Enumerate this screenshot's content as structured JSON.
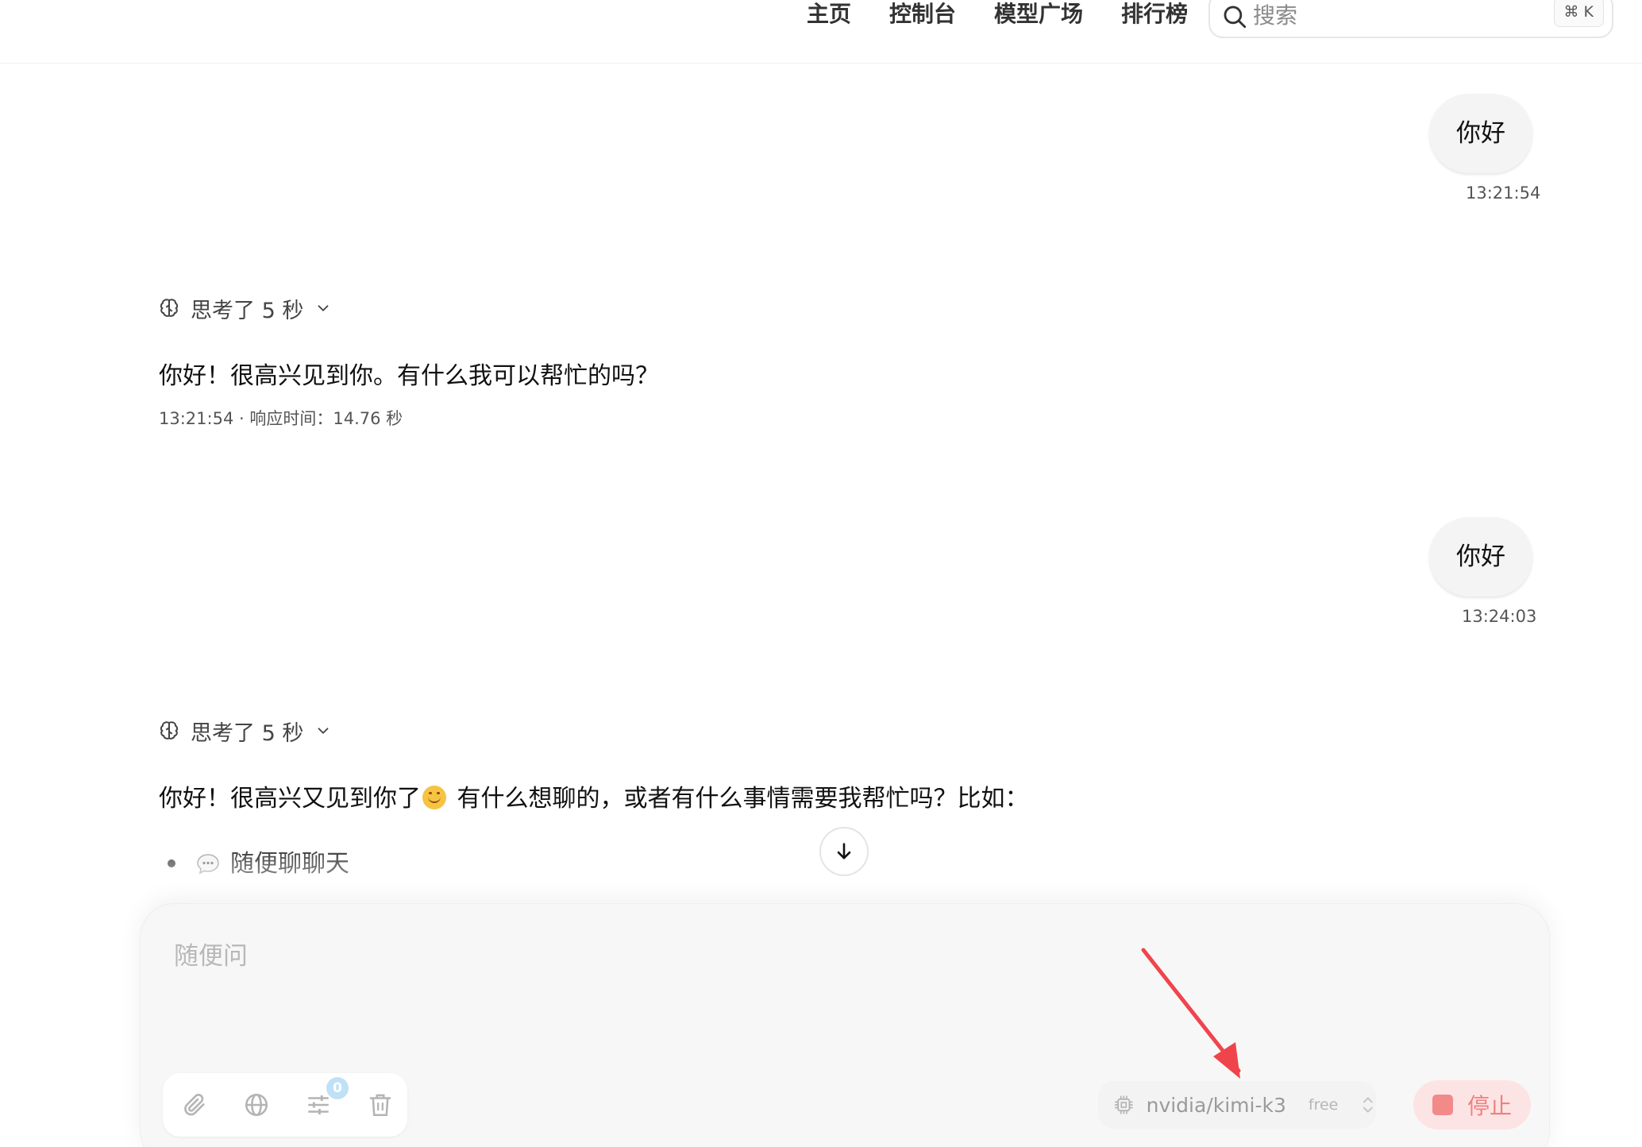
{
  "nav": {
    "links": [
      "主页",
      "控制台",
      "模型广场",
      "排行榜"
    ],
    "search_placeholder": "搜索",
    "shortcut": "⌘ K"
  },
  "conversation": {
    "messages": [
      {
        "role": "user",
        "text": "你好",
        "time": "13:21:54"
      },
      {
        "role": "assistant",
        "thinking": "思考了 5 秒",
        "text": "你好！很高兴见到你。有什么我可以帮忙的吗？",
        "meta": "13:21:54 · 响应时间：14.76 秒"
      },
      {
        "role": "user",
        "text": "你好",
        "time": "13:24:03"
      },
      {
        "role": "assistant",
        "thinking": "思考了 5 秒",
        "text_before_emoji": "你好！很高兴又见到你了",
        "text_after_emoji": " 有什么想聊的，或者有什么事情需要我帮忙吗？比如：",
        "emoji": "smiling-face-icon",
        "list": [
          "随便聊聊天"
        ],
        "list_icon": "speech-bubble-icon"
      }
    ]
  },
  "composer": {
    "placeholder": "随便问",
    "tools": [
      "attach-icon",
      "globe-icon",
      "sliders-icon",
      "trash-icon"
    ],
    "tools_badge": "0",
    "model": "nvidia/kimi-k3",
    "model_tier": "free",
    "stop_label": "停止"
  },
  "colors": {
    "stop_bg": "#fde4e4",
    "stop_fg": "#f07f7f",
    "annotation_arrow": "#f0444c",
    "badge": "#bfe1f6"
  }
}
